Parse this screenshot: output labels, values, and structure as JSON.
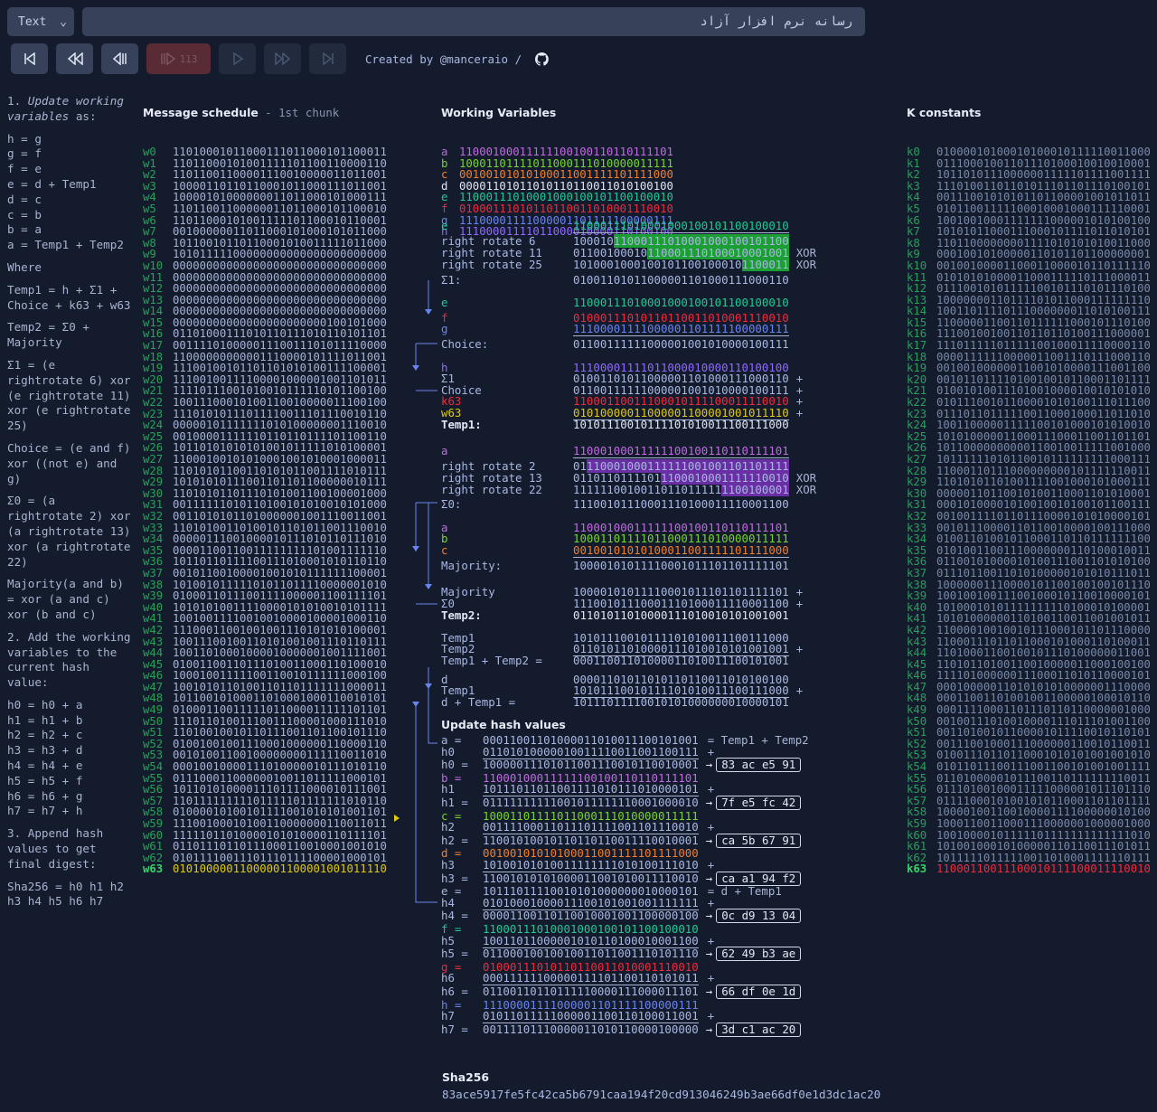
{
  "toolbar": {
    "select_value": "Text",
    "input_value": "رسانه نرم افزار آزاد",
    "step": "113",
    "credit": "Created by @manceraio /"
  },
  "left_panel": {
    "p1_num": "1. ",
    "p1_italic": "Update working variables",
    "p1_rest": " as:",
    "assign": [
      "h = g",
      "g = f",
      "f = e",
      "e = d + Temp1",
      "d = c",
      "c = b",
      "b = a",
      "a = Temp1 + Temp2"
    ],
    "where": "Where",
    "temp1": "Temp1 = h + Σ1 + Choice + k63 + w63",
    "temp2": "Temp2 = Σ0 + Majority",
    "sigma1": "Σ1 = (e rightrotate 6) xor (e rightrotate 11) xor (e rightrotate 25)",
    "choice": "Choice = (e and f) xor ((not e) and g)",
    "sigma0": "Σ0 = (a rightrotate 2) xor (a rightrotate 13) xor (a rightrotate 22)",
    "majority": "Majority(a and b) = xor (a and c) xor (b and c)",
    "p2": "2. Add the working variables to the current hash value:",
    "hadds": [
      "h0 = h0 + a",
      "h1 = h1 + b",
      "h2 = h2 + c",
      "h3 = h3 + d",
      "h4 = h4 + e",
      "h5 = h5 + f",
      "h6 = h6 + g",
      "h7 = h7 + h"
    ],
    "p3": "3. Append hash values to get final digest:",
    "final": "Sha256 = h0 h1 h2 h3 h4 h5 h6 h7"
  },
  "schedule": {
    "title": "Message schedule",
    "subtitle": " - 1st chunk",
    "words": [
      "11010001011000111011000101100011",
      "11011000101001111101100110000110",
      "11011001100001110010000011011001",
      "10000110110110001011000111011001",
      "10000101000000011011000101000111",
      "11011001100000011011000101100010",
      "11011000101001111101100010110001",
      "00100000011011000101000101011000",
      "10110010110110001010011111011000",
      "10101111100000000000000000000000",
      "00000000000000000000000000000000",
      "00000000000000000000000000000000",
      "00000000000000000000000000000000",
      "00000000000000000000000000000000",
      "00000000000000000000000000000000",
      "00000000000000000000000100101000",
      "01101000111010110111010110101101",
      "00111101000001110011101011110000",
      "11000000000001110000101111011001",
      "11100100101101101010100111100001",
      "11100100111100001000001001101011",
      "11110111001010010111110101100100",
      "10011100010100110010000011100100",
      "11101010111011110011101110010110",
      "00000101111111010100000001110010",
      "00100001111110110110111101100110",
      "10110101010101001011111010100001",
      "11000100101010001001010001000011",
      "11010101100110101011001111010111",
      "10101010111001101101100000010111",
      "11010101101110101001100100001000",
      "00111111010110100101010010101000",
      "00110101011010000001001110011001",
      "11010100110100101101011001110010",
      "00000111001000010111010110111010",
      "00001100110011111111101001111110",
      "10110110111100111010001010110110",
      "00101100100001001010111111100001",
      "10100101111101011011110000001010",
      "01000110111001111000001100111101",
      "10101010011110000101010010101111",
      "10010011110010010000100001000110",
      "11100011001001001110101010100001",
      "10011100100110101001001110110111",
      "10011010001000010000001001111001",
      "01001100110111010011000110100010",
      "10001001111100110010111111000100",
      "10010101101001101101111111000011",
      "10110010100011010001000110010101",
      "01000110011111011000011111101101",
      "11101101001110011100001000111010",
      "11010010010110111001101100101110",
      "01001001001110001000000110000110",
      "00101001100100000000111110011010",
      "00010010000111010000010111010110",
      "01110001100000010011011111000101",
      "10110101000011101111000010111001",
      "11011111111101111101111111010110",
      "01000010100101111001010101001101",
      "11100100010100110000000110011011",
      "11111011010000101010000110111101",
      "01101110110111000110010001001010",
      "01011110011101110111100001000101",
      "01010000011000001100001001011110"
    ]
  },
  "working": {
    "title": "Working Variables",
    "vars": [
      {
        "n": "a",
        "v": "11000100011111100100110110111101",
        "c": "#c06be0"
      },
      {
        "n": "b",
        "v": "10001101111011000111010000011111",
        "c": "#77d52b"
      },
      {
        "n": "c",
        "v": "00100101010100011001111101111000",
        "c": "#f07f2b"
      },
      {
        "n": "d",
        "v": "00001101011010110110011010100100",
        "c": "#e1e6f2"
      },
      {
        "n": "e",
        "v": "11000111010001000100101100100010",
        "c": "#20c996"
      },
      {
        "n": "f",
        "v": "01000111010110110011010001110010",
        "c": "#ee2b3c"
      },
      {
        "n": "g",
        "v": "11100001111000001101111100000111",
        "c": "#6a84ef"
      },
      {
        "n": "h",
        "v": "11100001111011000010000110100100",
        "c": "#8f6bff"
      }
    ]
  },
  "compute": {
    "e_val": "11000111010001000100101100100010",
    "rr6": "10001011000111010001000100101100",
    "rr11": "01100100010110001110100010001001",
    "rr25": "10100010001001011001000101100011",
    "sigma1": "01001101011000001101000111000110",
    "f_val": "01000111010110110011010001110010",
    "g_val": "11100001111000001101111100000111",
    "choice": "01100111111000001001010000100111",
    "h_val": "11100001111011000010000110100100",
    "k63": "11000110011100010111100011110010",
    "w63": "01010000011000001100001001011110",
    "temp1": "10101110010111101010011100111000",
    "a_val": "11000100011111100100110110111101",
    "rr2": "01110001000111111001001101101111",
    "rr13": "01101101111011100010001111110010",
    "rr22": "11111100100110110111111100100001",
    "sigma0": "11100101110001110100011110001100",
    "b_val": "10001101111011000111010000011111",
    "c_val": "00100101010100011001111101111000",
    "majority": "10000101011110001011101101111101",
    "temp2": "01101011010000111010010101001001",
    "temp1_plus_temp2": "00011001101000011010011100101001",
    "d_val": "00001101011010110110011010100100",
    "d_plus_temp1": "10111011110010101000000010000101",
    "labels": {
      "e": "e",
      "rr6": "right rotate 6",
      "rr11": "right rotate 11",
      "rr25": "right rotate 25",
      "s1": "Σ1:",
      "f": "f",
      "g": "g",
      "choice": "Choice:",
      "h": "h",
      "sig1": "Σ1",
      "ch": "Choice",
      "k63": "k63",
      "w63": "w63",
      "temp1": "Temp1:",
      "a": "a",
      "rr2": "right rotate 2",
      "rr13": "right rotate 13",
      "rr22": "right rotate 22",
      "s0": "Σ0:",
      "b": "b",
      "c": "c",
      "maj": "Majority:",
      "maj2": "Majority",
      "sig0": "Σ0",
      "temp2": "Temp2:",
      "t1": "Temp1",
      "t2": "Temp2",
      "t1t2": "Temp1 + Temp2 =",
      "d": "d",
      "dt1": "d + Temp1 =",
      "xor": "XOR",
      "plus": "+"
    }
  },
  "update": {
    "title": "Update hash values",
    "note_a": "= Temp1 + Temp2",
    "note_e": "= d + Temp1",
    "rows": [
      {
        "var": "a =",
        "var_val": "00011001101000011010011100101001",
        "vc": "#a9b8e2",
        "h": "h0",
        "h_old": "01101010000010011110011001100111",
        "res": "h0 =",
        "res_val": "10000011101011001110010110010001",
        "hex": "83 ac e5 91"
      },
      {
        "var": "b =",
        "var_val": "11000100011111100100110110111101",
        "vc": "#c06be0",
        "h": "h1",
        "h_old": "10111011011001111010111010000101",
        "res": "h1 =",
        "res_val": "01111111111001011111110001000010",
        "hex": "7f e5 fc 42"
      },
      {
        "var": "c =",
        "var_val": "10001101111011000111010000011111",
        "vc": "#77d52b",
        "h": "h2",
        "h_old": "00111100011011101111001101110010",
        "res": "h2 =",
        "res_val": "11001010010110110110011110010001",
        "hex": "ca 5b 67 91"
      },
      {
        "var": "d =",
        "var_val": "00100101010100011001111101111000",
        "vc": "#f07f2b",
        "h": "h3",
        "h_old": "10100101010011111111010100111010",
        "res": "h3 =",
        "res_val": "11001010101000011001010011110010",
        "hex": "ca a1 94 f2"
      },
      {
        "var": "e =",
        "var_val": "10111011110010101000000010000101",
        "vc": "#a9b8e2",
        "h": "h4",
        "h_old": "01010001000011100101001001111111",
        "res": "h4 =",
        "res_val": "00001100110110010001001100000100",
        "hex": "0c d9 13 04"
      },
      {
        "var": "f =",
        "var_val": "11000111010001000100101100100010",
        "vc": "#20c996",
        "h": "h5",
        "h_old": "10011011000001010110100010001100",
        "res": "h5 =",
        "res_val": "01100010010010011011001110101110",
        "hex": "62 49 b3 ae"
      },
      {
        "var": "g =",
        "var_val": "01000111010110110011010001110010",
        "vc": "#ee2b3c",
        "h": "h6",
        "h_old": "00011111100000111101100110101011",
        "res": "h6 =",
        "res_val": "01100110110111110000111000011101",
        "hex": "66 df 0e 1d"
      },
      {
        "var": "h =",
        "var_val": "11100001111000001101111100000111",
        "vc": "#6a84ef",
        "h": "h7",
        "h_old": "01011011111000001100110100011001",
        "res": "h7 =",
        "res_val": "00111101110000011010110000100000",
        "hex": "3d c1 ac 20"
      }
    ]
  },
  "sha": {
    "title": "Sha256",
    "value": "83ace5917fe5fc42ca5b6791caa194f20cd913046249b3ae66df0e1d3dc1ac20"
  },
  "kconst": {
    "title": "K constants",
    "values": [
      "01000010100010100010111110011000",
      "01110001001101110100010010010001",
      "10110101110000001111101111001111",
      "11101001101101011101101110100101",
      "00111001010101101100001001011011",
      "01011001111100010001000111110001",
      "10010010001111111000001010100100",
      "10101011000111000101111011010101",
      "11011000000001111010101010011000",
      "00010010100000110101101100000001",
      "00100100001100011000010110111110",
      "01010101000011000111110111000011",
      "01110010101111100101110101110100",
      "10000000110111101011000111111110",
      "10011011110111000000011010100111",
      "11000001100110111111000101110100",
      "11100100100110110110100111000001",
      "11101111101111100100011110000110",
      "00001111110000011001110111000110",
      "00100100000011001010000111001100",
      "00101101111010010010110001101111",
      "01001010011101001000010010101010",
      "01011100101100001010100111011100",
      "01110110111110011000100011011010",
      "10011000001111100101000101010010",
      "10101000001100011100011001101101",
      "10110000000000110010011111001000",
      "10111111010110010111111111000111",
      "11000110111000000000101111110011",
      "11010101101001111001000101000111",
      "00000110110010100110001101010001",
      "00010100001010010010100101100111",
      "00100111101101110000101010000101",
      "00101110000110110010000100111000",
      "01001101001011000110110111111100",
      "01010011001110000000110100010011",
      "01100101000010100111001101010100",
      "01110110011010100000101010111011",
      "10000001110000101100100100101110",
      "10010010011100100010110010000101",
      "10100010101111111110100010100001",
      "10101000000110100110011001001011",
      "11000010010010111000101101110000",
      "11000111011011000101000110100011",
      "11010001100100101110100000011001",
      "11010110100110010000011000100100",
      "11110100000011100011010110000101",
      "00010000011010101010000001110000",
      "00011001101001001100000100010110",
      "00011110001101110110110000001000",
      "00100111010010000111011101001100",
      "00110100101100001011110010110101",
      "00111001000111000000110010110011",
      "01001110110110001010101001001010",
      "01011011100111001100101001001111",
      "01101000001011100110111111110011",
      "01110100100011111000001011101110",
      "01111000101001010110001101101111",
      "10000100110010000111100000010100",
      "10001100110001110000001000001000",
      "10010000101111101111111111111010",
      "10100100010100000110110011101011",
      "10111110111110011010001111110111",
      "11000110011100010111100011110010"
    ]
  }
}
